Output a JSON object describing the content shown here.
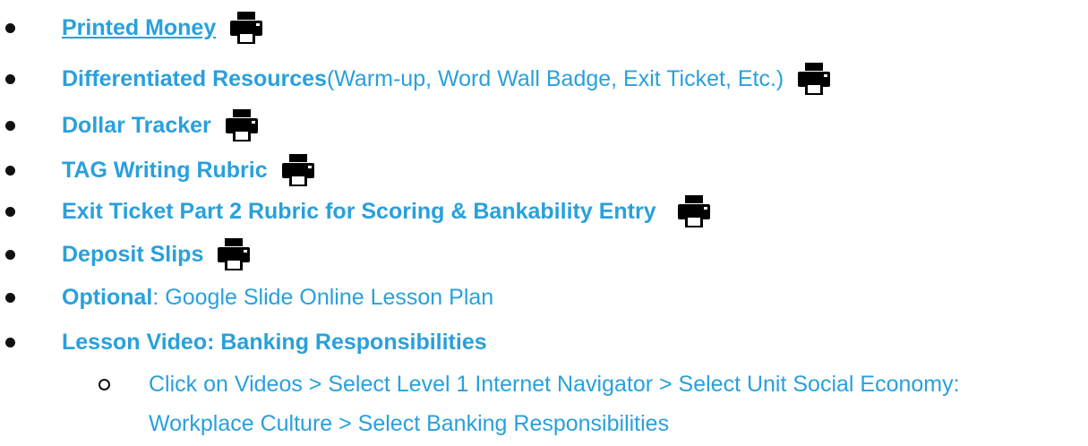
{
  "items": [
    {
      "bold": "Printed Money",
      "rest": "",
      "link": true,
      "printer": true
    },
    {
      "bold": "Differentiated Resources",
      "rest": " (Warm-up, Word Wall Badge, Exit Ticket, Etc.)",
      "link": false,
      "printer": true
    },
    {
      "bold": "Dollar Tracker",
      "rest": "",
      "link": false,
      "printer": true
    },
    {
      "bold": "TAG Writing Rubric",
      "rest": "",
      "link": false,
      "printer": true
    },
    {
      "bold": "Exit Ticket Part 2 Rubric for Scoring & Bankability Entry",
      "rest": "",
      "link": false,
      "printer": true
    },
    {
      "bold": "Deposit Slips",
      "rest": "",
      "link": false,
      "printer": true
    },
    {
      "bold": "Optional",
      "rest": ": Google Slide Online Lesson Plan",
      "link": false,
      "printer": false
    },
    {
      "bold": "Lesson Video: Banking Responsibilities",
      "rest": "",
      "link": false,
      "printer": false
    }
  ],
  "sub_item": {
    "line1": "Click on Videos > Select Level 1 Internet Navigator > Select Unit Social Economy:",
    "line2": "Workplace Culture > Select Banking Responsibilities"
  },
  "icons": {
    "printer": "printer-icon"
  },
  "colors": {
    "text": "#29a0dc",
    "bullet": "#111111",
    "icon": "#000000"
  }
}
